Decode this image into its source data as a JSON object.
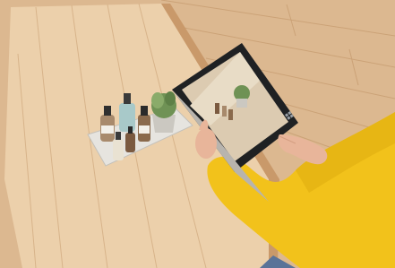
{
  "scene": {
    "colors": {
      "floor": "#d9b48c",
      "floor_dark": "#b98b5f",
      "table_top": "#e8c9a2",
      "table_edge": "#c99a6a",
      "tray": "#e4e2dd",
      "sweater": "#f2c21b",
      "sweater_shade": "#d9a80c",
      "tablet_frame": "#1f2123",
      "tablet_screen": "#d8c7ad",
      "plant": "#6d8f52",
      "pot": "#c9c6bf",
      "skin": "#e8b59a",
      "jeans": "#5b7398"
    },
    "icons": {
      "logo_on_tablet": "windows-logo-icon"
    }
  }
}
